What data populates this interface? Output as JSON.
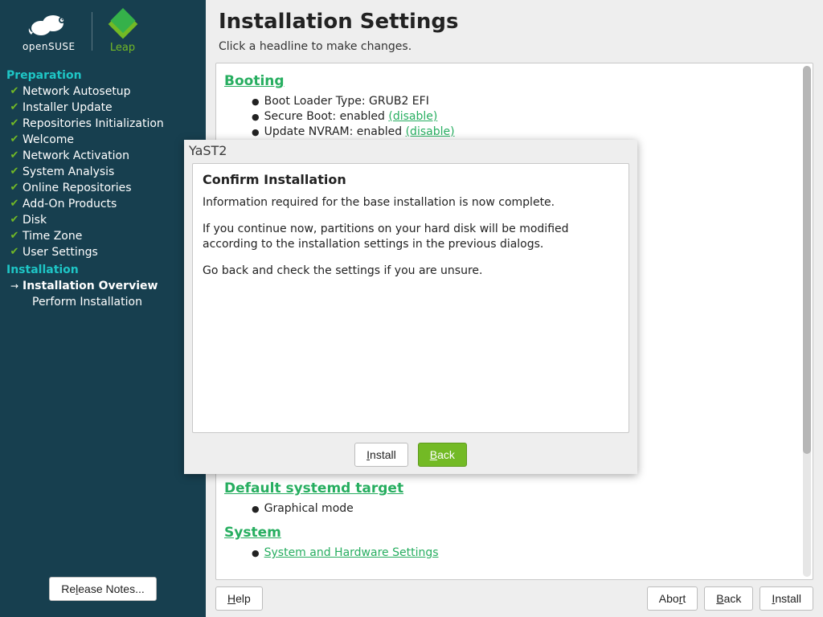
{
  "brand": {
    "os": "openSUSE",
    "edition": "Leap"
  },
  "nav": {
    "sections": [
      {
        "title": "Preparation",
        "items": [
          {
            "label": "Network Autosetup",
            "checked": true
          },
          {
            "label": "Installer Update",
            "checked": true
          },
          {
            "label": "Repositories Initialization",
            "checked": true
          },
          {
            "label": "Welcome",
            "checked": true
          },
          {
            "label": "Network Activation",
            "checked": true
          },
          {
            "label": "System Analysis",
            "checked": true
          },
          {
            "label": "Online Repositories",
            "checked": true
          },
          {
            "label": "Add-On Products",
            "checked": true
          },
          {
            "label": "Disk",
            "checked": true
          },
          {
            "label": "Time Zone",
            "checked": true
          },
          {
            "label": "User Settings",
            "checked": true
          }
        ]
      },
      {
        "title": "Installation",
        "items": [
          {
            "label": "Installation Overview",
            "current": true
          },
          {
            "label": "Perform Installation"
          }
        ]
      }
    ]
  },
  "sidebar": {
    "release_notes": "Release Notes..."
  },
  "page": {
    "title": "Installation Settings",
    "subtitle": "Click a headline to make changes.",
    "sections": {
      "booting": {
        "title": "Booting",
        "items": [
          {
            "text": "Boot Loader Type: GRUB2 EFI"
          },
          {
            "text": "Secure Boot: enabled ",
            "link": "(disable)"
          },
          {
            "text": "Update NVRAM: enabled ",
            "link": "(disable)"
          }
        ]
      },
      "systemd": {
        "title": "Default systemd target",
        "items": [
          {
            "text": "Graphical mode"
          }
        ]
      },
      "system": {
        "title": "System",
        "items": [
          {
            "link_only": "System and Hardware Settings"
          }
        ]
      }
    }
  },
  "footer": {
    "help": "Help",
    "abort": "Abort",
    "back": "Back",
    "install": "Install",
    "help_u": "H",
    "abort_u": "r",
    "back_u": "B",
    "install_u": "I"
  },
  "modal": {
    "window_title": "YaST2",
    "heading": "Confirm Installation",
    "p1": "Information required for the base installation is now complete.",
    "p2": "If you continue now, partitions on your hard disk will be modified according to the installation settings in the previous dialogs.",
    "p3": "Go back and check the settings if you are unsure.",
    "install": "Install",
    "install_u": "I",
    "back": "Back",
    "back_u": "B"
  }
}
